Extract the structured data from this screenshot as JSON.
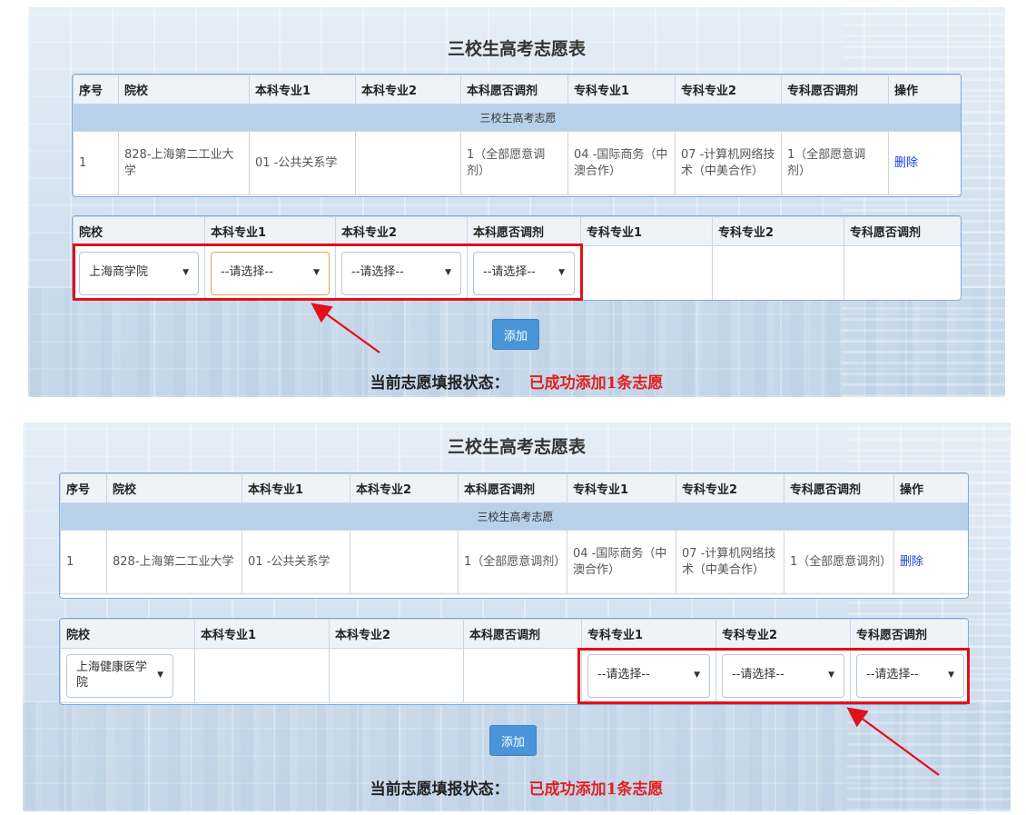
{
  "colors": {
    "accent": "#4a95d9",
    "highlight": "#e2101b",
    "status_value": "#e02020",
    "link": "#1a3fe0"
  },
  "screens": [
    {
      "title": "三校生高考志愿表",
      "list": {
        "headers": [
          "序号",
          "院校",
          "本科专业1",
          "本科专业2",
          "本科愿否调剂",
          "专科专业1",
          "专科专业2",
          "专科愿否调剂",
          "操作"
        ],
        "group_label": "三校生高考志愿",
        "row": [
          "1",
          "828-上海第二工业大学",
          "01 -公共关系学",
          "",
          "1（全部愿意调剂）",
          "04 -国际商务（中澳合作）",
          "07 -计算机网络技术（中美合作）",
          "1（全部愿意调剂）"
        ],
        "action": "删除"
      },
      "form": {
        "headers": [
          "院校",
          "本科专业1",
          "本科专业2",
          "本科愿否调剂",
          "专科专业1",
          "专科专业2",
          "专科愿否调剂"
        ],
        "selects": [
          "上海商学院",
          "--请选择--",
          "--请选择--",
          "--请选择--"
        ]
      },
      "add_button": "添加",
      "status_label": "当前志愿填报状态：",
      "status_value": "已成功添加1条志愿"
    },
    {
      "title": "三校生高考志愿表",
      "list": {
        "headers": [
          "序号",
          "院校",
          "本科专业1",
          "本科专业2",
          "本科愿否调剂",
          "专科专业1",
          "专科专业2",
          "专科愿否调剂",
          "操作"
        ],
        "group_label": "三校生高考志愿",
        "row": [
          "1",
          "828-上海第二工业大学",
          "01 -公共关系学",
          "",
          "1（全部愿意调剂）",
          "04 -国际商务（中澳合作）",
          "07 -计算机网络技术（中美合作）",
          "1（全部愿意调剂）"
        ],
        "action": "删除"
      },
      "form": {
        "headers": [
          "院校",
          "本科专业1",
          "本科专业2",
          "本科愿否调剂",
          "专科专业1",
          "专科专业2",
          "专科愿否调剂"
        ],
        "selects": [
          "上海健康医学院",
          "--请选择--",
          "--请选择--",
          "--请选择--"
        ]
      },
      "add_button": "添加",
      "status_label": "当前志愿填报状态：",
      "status_value": "已成功添加1条志愿"
    }
  ]
}
